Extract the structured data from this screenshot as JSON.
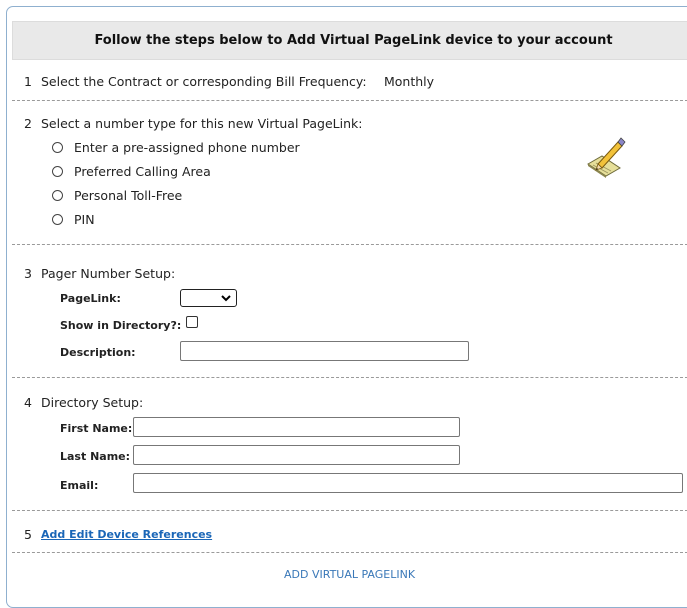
{
  "header": {
    "title": "Follow the steps below to Add Virtual PageLink device to your account"
  },
  "step1": {
    "number": "1",
    "text": "Select the Contract or corresponding Bill Frequency:",
    "value": "Monthly"
  },
  "step2": {
    "number": "2",
    "text": "Select a number type for this new Virtual PageLink:",
    "options": [
      "Enter a pre-assigned phone number",
      "Preferred Calling Area",
      "Personal Toll-Free",
      "PIN"
    ],
    "icon": "pencil-edit-icon"
  },
  "step3": {
    "number": "3",
    "text": "Pager Number Setup:",
    "pagelink_label": "PageLink:",
    "show_dir_label": "Show in Directory?:",
    "description_label": "Description:"
  },
  "step4": {
    "number": "4",
    "text": "Directory Setup:",
    "first_name_label": "First Name:",
    "last_name_label": "Last Name:",
    "email_label": "Email:"
  },
  "step5": {
    "number": "5",
    "link": "Add Edit Device References"
  },
  "footer": {
    "button": "ADD VIRTUAL PAGELINK"
  },
  "colors": {
    "link": "#1a66b7",
    "header_bg": "#e9e9e9",
    "frame_border": "#8fb0cf"
  }
}
